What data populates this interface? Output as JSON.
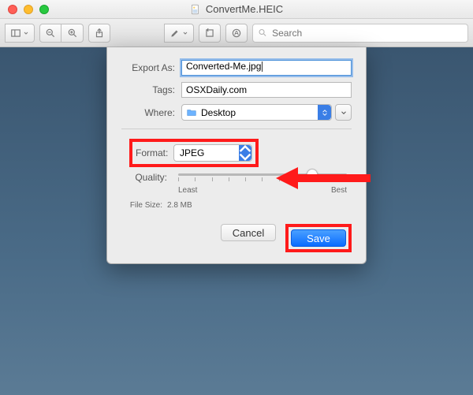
{
  "window": {
    "title": "ConvertMe.HEIC"
  },
  "toolbar": {
    "search_placeholder": "Search"
  },
  "sheet": {
    "labels": {
      "export_as": "Export As:",
      "tags": "Tags:",
      "where": "Where:",
      "format": "Format:",
      "quality": "Quality:",
      "file_size": "File Size:"
    },
    "export_as_value": "Converted-Me.jpg",
    "tags_value": "OSXDaily.com",
    "where_value": "Desktop",
    "format_value": "JPEG",
    "quality_fraction": 0.78,
    "quality_min_label": "Least",
    "quality_max_label": "Best",
    "file_size_value": "2.8 MB",
    "cancel": "Cancel",
    "save": "Save"
  },
  "annotation": {
    "highlight_color": "#ff1a1a"
  }
}
